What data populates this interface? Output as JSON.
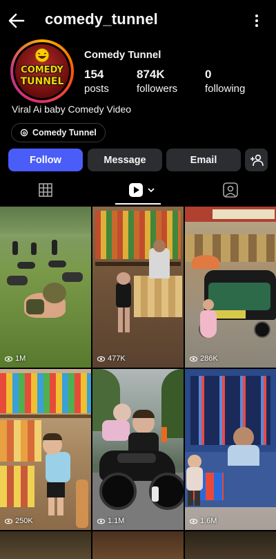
{
  "header": {
    "username": "comedy_tunnel",
    "back_icon": "arrow-left-icon",
    "more_icon": "more-vertical-icon"
  },
  "profile": {
    "avatar_logo_top": "COMEDY",
    "avatar_logo_bottom": "TUNNEL",
    "display_name": "Comedy Tunnel",
    "stats": {
      "posts": {
        "value": "154",
        "label": "posts"
      },
      "followers": {
        "value": "874K",
        "label": "followers"
      },
      "following": {
        "value": "0",
        "label": "following"
      }
    },
    "bio": "Viral Ai baby Comedy Video",
    "threads_chip": "Comedy Tunnel"
  },
  "actions": {
    "follow": "Follow",
    "message": "Message",
    "email": "Email",
    "add_user_icon": "add-person-icon"
  },
  "tabs": [
    {
      "icon": "grid-icon",
      "active": false
    },
    {
      "icon": "reels-icon",
      "active": true
    },
    {
      "icon": "tagged-icon",
      "active": false
    }
  ],
  "posts": [
    {
      "views": "1M",
      "scene": "babies crawling on grass field"
    },
    {
      "views": "477K",
      "scene": "baby in grocery shop"
    },
    {
      "views": "286K",
      "scene": "girl near auto rickshaw"
    },
    {
      "views": "250K",
      "scene": "baby at snacks shelf"
    },
    {
      "views": "1.1M",
      "scene": "babies on motorbike"
    },
    {
      "views": "1.6M",
      "scene": "baby at mobile phone store"
    }
  ],
  "colors": {
    "follow_button": "#4a5df9",
    "secondary_button": "#2b2d31",
    "background": "#000000"
  }
}
